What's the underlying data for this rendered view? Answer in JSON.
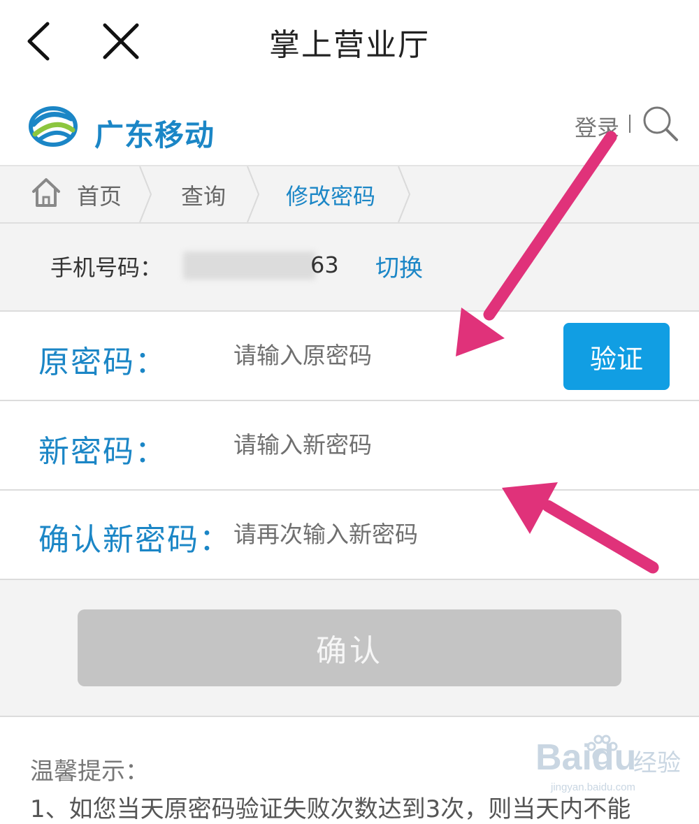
{
  "app_bar": {
    "title": "掌上营业厅",
    "back_icon": "chevron-left-icon",
    "close_icon": "close-icon"
  },
  "site_header": {
    "brand": "广东移动",
    "login": "登录",
    "search_icon": "search-icon",
    "brand_color": "#1b86c6"
  },
  "breadcrumb": {
    "home": "首页",
    "items": [
      "查询",
      "修改密码"
    ]
  },
  "phone": {
    "label": "手机号码：",
    "number_visible_suffix": "63",
    "switch_label": "切换"
  },
  "form": {
    "old_password": {
      "label": "原密码：",
      "placeholder": "请输入原密码"
    },
    "verify_label": "验证",
    "new_password": {
      "label": "新密码：",
      "placeholder": "请输入新密码"
    },
    "confirm_password": {
      "label": "确认新密码：",
      "placeholder": "请再次输入新密码"
    },
    "submit_label": "确认",
    "accent_color": "#119ee3"
  },
  "tips": {
    "title": "温馨提示：",
    "line1": "1、如您当天原密码验证失败次数达到3次，则当天内不能"
  },
  "watermark": {
    "brand": "Baidu",
    "suffix": "经验",
    "url": "jingyan.baidu.com"
  }
}
